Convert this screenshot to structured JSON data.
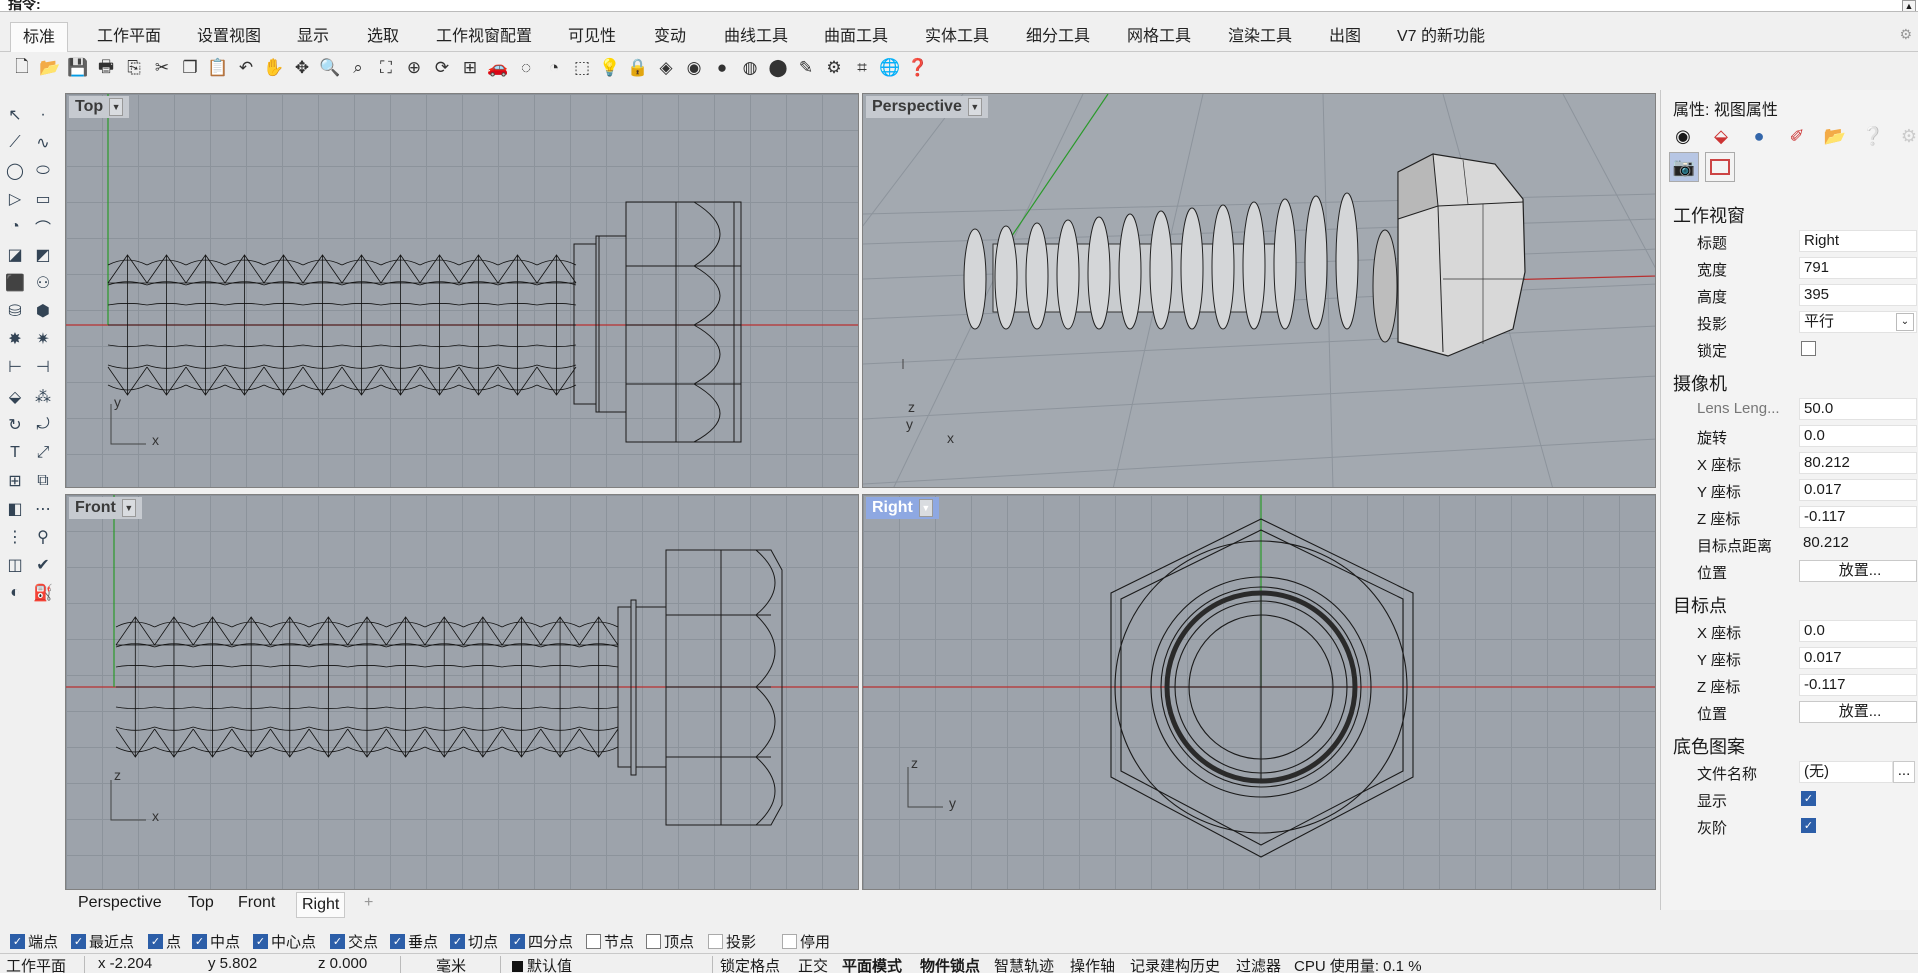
{
  "command": {
    "prompt": "指令:"
  },
  "tabs": [
    {
      "label": "标准",
      "active": true
    },
    {
      "label": "工作平面"
    },
    {
      "label": "设置视图"
    },
    {
      "label": "显示"
    },
    {
      "label": "选取"
    },
    {
      "label": "工作视窗配置"
    },
    {
      "label": "可见性"
    },
    {
      "label": "变动"
    },
    {
      "label": "曲线工具"
    },
    {
      "label": "曲面工具"
    },
    {
      "label": "实体工具"
    },
    {
      "label": "细分工具"
    },
    {
      "label": "网格工具"
    },
    {
      "label": "渲染工具"
    },
    {
      "label": "出图"
    },
    {
      "label": "V7 的新功能"
    }
  ],
  "toolbar_icons": [
    "new",
    "open",
    "save",
    "print",
    "import",
    "cut",
    "copy",
    "paste",
    "undo",
    "pan",
    "move",
    "zoom-in",
    "zoom-window",
    "zoom-extents",
    "zoom-selected",
    "rotate-view",
    "four-viewports",
    "car",
    "hide",
    "show",
    "select",
    "light",
    "lock",
    "layer",
    "color",
    "shade",
    "render",
    "material",
    "text",
    "options",
    "grid",
    "globe",
    "help"
  ],
  "viewports": {
    "top": {
      "label": "Top",
      "axis_x": "x",
      "axis_y": "y"
    },
    "perspective": {
      "label": "Perspective",
      "axis_x": "x",
      "axis_y": "y",
      "axis_z": "z"
    },
    "front": {
      "label": "Front",
      "axis_x": "x",
      "axis_z": "z"
    },
    "right": {
      "label": "Right",
      "axis_y": "y",
      "axis_z": "z",
      "active": true
    }
  },
  "viewport_tabs": [
    {
      "label": "Perspective"
    },
    {
      "label": "Top"
    },
    {
      "label": "Front"
    },
    {
      "label": "Right",
      "active": true
    },
    {
      "label": "+"
    }
  ],
  "osnaps": [
    {
      "label": "端点",
      "checked": true
    },
    {
      "label": "最近点",
      "checked": true
    },
    {
      "label": "点",
      "checked": true
    },
    {
      "label": "中点",
      "checked": true
    },
    {
      "label": "中心点",
      "checked": true
    },
    {
      "label": "交点",
      "checked": true
    },
    {
      "label": "垂点",
      "checked": true
    },
    {
      "label": "切点",
      "checked": true
    },
    {
      "label": "四分点",
      "checked": true
    },
    {
      "label": "节点",
      "checked": false
    },
    {
      "label": "顶点",
      "checked": false
    },
    {
      "label": "投影",
      "checked": false
    },
    {
      "label": "停用",
      "checked": false
    }
  ],
  "status": {
    "cplane": "工作平面",
    "x": "x -2.204",
    "y": "y 5.802",
    "z": "z 0.000",
    "units": "毫米",
    "layer": "默认值",
    "grid_snap": "锁定格点",
    "ortho": "正交",
    "planar": "平面模式",
    "osnap": "物件锁点",
    "smarttrack": "智慧轨迹",
    "gumball": "操作轴",
    "history": "记录建构历史",
    "filter": "过滤器",
    "cpu": "CPU 使用量: 0.1 %"
  },
  "panel": {
    "title": "属性: 视图属性",
    "viewport_section": "工作视窗",
    "title_label": "标题",
    "title_value": "Right",
    "width_label": "宽度",
    "width_value": "791",
    "height_label": "高度",
    "height_value": "395",
    "projection_label": "投影",
    "projection_value": "平行",
    "lock_label": "锁定",
    "camera_section": "摄像机",
    "lens_label": "Lens Leng...",
    "lens_value": "50.0",
    "rotation_label": "旋转",
    "rotation_value": "0.0",
    "cam_x_label": "X 座标",
    "cam_x_value": "80.212",
    "cam_y_label": "Y 座标",
    "cam_y_value": "0.017",
    "cam_z_label": "Z 座标",
    "cam_z_value": "-0.117",
    "target_dist_label": "目标点距离",
    "target_dist_value": "80.212",
    "position_label": "位置",
    "place_button": "放置...",
    "target_section": "目标点",
    "tgt_x_label": "X 座标",
    "tgt_x_value": "0.0",
    "tgt_y_label": "Y 座标",
    "tgt_y_value": "0.017",
    "tgt_z_label": "Z 座标",
    "tgt_z_value": "-0.117",
    "tgt_position_label": "位置",
    "tgt_place_button": "放置...",
    "wallpaper_section": "底色图案",
    "filename_label": "文件名称",
    "filename_value": "(无)",
    "browse_button": "...",
    "show_label": "显示",
    "gray_label": "灰阶"
  }
}
